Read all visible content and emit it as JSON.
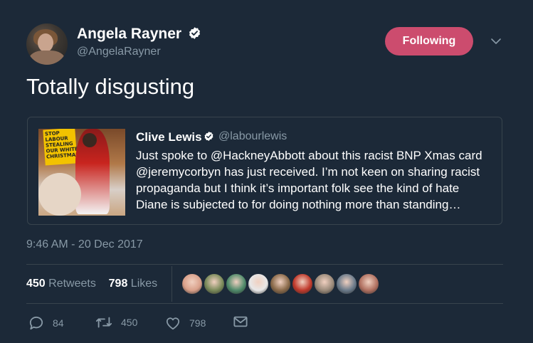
{
  "author": {
    "display_name": "Angela Rayner",
    "handle": "@AngelaRayner",
    "verified": true
  },
  "follow_button": {
    "label": "Following",
    "color": "#cc4c6e"
  },
  "tweet": {
    "text": "Totally disgusting",
    "timestamp": "9:46 AM - 20 Dec 2017"
  },
  "quoted_tweet": {
    "display_name": "Clive Lewis",
    "handle": "@labourlewis",
    "verified": true,
    "text": "Just spoke to @HackneyAbbott about this racist BNP Xmas card\n@jeremycorbyn has just received. I’m not keen on sharing racist\npropaganda but I think it’s important folk see the kind of hate\nDiane is subjected to for doing nothing more than standing…",
    "image_text": "STOP\nLABOUR\nSTEALING\nOUR WHITE\nCHRISTMAS"
  },
  "stats": {
    "retweets_count": "450",
    "retweets_label": "Retweets",
    "likes_count": "798",
    "likes_label": "Likes"
  },
  "likers": [
    {
      "color": "#d9a08a"
    },
    {
      "color": "#7a8a5a"
    },
    {
      "color": "#4f8a6a"
    },
    {
      "color": "#e8e8e8"
    },
    {
      "color": "#8a6a4a"
    },
    {
      "color": "#c0392b"
    },
    {
      "color": "#9a8a7a"
    },
    {
      "color": "#6a7a8a"
    },
    {
      "color": "#b07060"
    }
  ],
  "actions": {
    "reply_count": "84",
    "retweet_count": "450",
    "like_count": "798"
  },
  "colors": {
    "background": "#1c2938",
    "secondary_text": "#8899a6",
    "divider": "#38444d"
  }
}
